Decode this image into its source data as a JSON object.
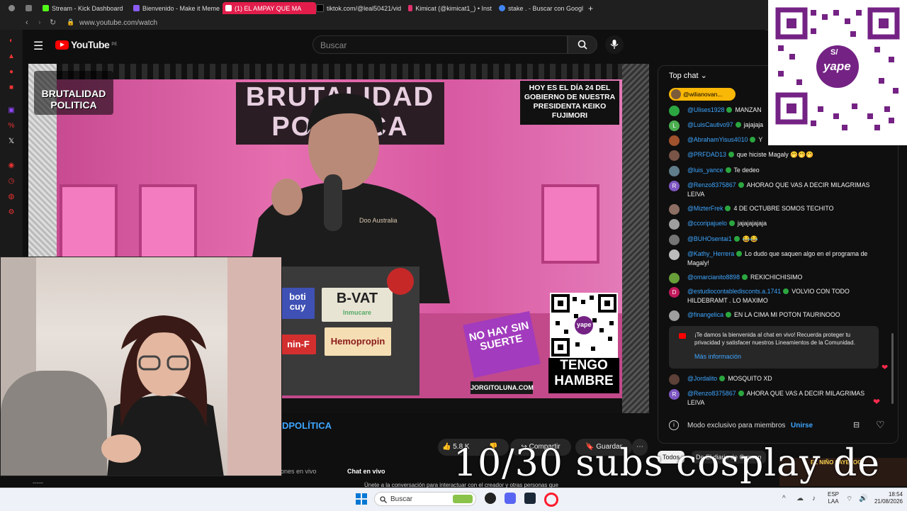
{
  "browser": {
    "tabs": [
      {
        "label": "Stream - Kick Dashboard",
        "color": "#53fc18"
      },
      {
        "label": "Bienvenido - Make it Meme",
        "color": "#8b5cf6"
      },
      {
        "label": "(1) EL AMPAY QUE MA",
        "color": "#ff0000",
        "active": true
      },
      {
        "label": "tiktok.com/@leal50421/vid",
        "color": "#000000"
      },
      {
        "label": "Kimicat (@kimicat1_) • Inst",
        "color": "#e1306c"
      },
      {
        "label": "stake . - Buscar con Googl",
        "color": "#4285f4"
      }
    ],
    "new_tab": "+",
    "url": "www.youtube.com/watch"
  },
  "youtube": {
    "logo": "YouTube",
    "region": "PE",
    "search_placeholder": "Buscar"
  },
  "video": {
    "brand": "BRUTALIDAD POLITICA",
    "sign_line1": "BRUTALIDAD",
    "sign_line2": "POLITICA",
    "day_text": "HOY ES EL DÍA 24 DEL GOBIERNO DE NUESTRA PRESIDENTA KEIKO FUJIMORI",
    "shirt_text": "Doo Australia",
    "stickers": [
      "boti cuy",
      "B-VAT",
      "Inmucare",
      "Hemopropin",
      "nin-F"
    ],
    "qr_label": "yape",
    "hambre": "TENGO HAMBRE",
    "nohay": "NO HAY SIN SUERTE",
    "jorgito": "JORGITOLUNA.COM"
  },
  "below": {
    "title_fragment": "DPOLÍTICA",
    "likes": "5.8 K",
    "share": "Compartir",
    "save": "Guardar",
    "more": "⋯",
    "live_tab": "ones en vivo",
    "chat_tab": "Chat en vivo",
    "join_text": "Únete a la conversación para interactuar con el creador y otras personas que"
  },
  "chat": {
    "header": "Top chat",
    "pinned": "@wilianovan...",
    "messages": [
      {
        "author": "@Ulises1928",
        "text": "MANZAN",
        "color": "#2ba640",
        "initial": ""
      },
      {
        "author": "@LuisCautivo97",
        "text": "jajajaja",
        "color": "#4caf50",
        "initial": "L"
      },
      {
        "author": "@AbrahamYisus4010",
        "text": "Y",
        "color": "#a0522d",
        "initial": ""
      },
      {
        "author": "@PRFDAD13",
        "text": "que hiciste Magaly 🤭🤭🤭",
        "color": "#795548",
        "initial": ""
      },
      {
        "author": "@luis_yance",
        "text": "Te dedeo",
        "color": "#607d8b",
        "initial": ""
      },
      {
        "author": "@Renzo8375867",
        "text": "AHORAO QUE VAS A DECIR MILAGRIMAS LEIVA",
        "color": "#7e57c2",
        "initial": "R"
      },
      {
        "author": "@MizterFrek",
        "text": "4 DE OCTUBRE SOMOS TECHITO",
        "color": "#8d6e63",
        "initial": ""
      },
      {
        "author": "@ccoripajuelo",
        "text": "jajajajajaja",
        "color": "#9e9e9e",
        "initial": ""
      },
      {
        "author": "@BUHOsentai1",
        "text": "😂😂",
        "color": "#757575",
        "initial": ""
      },
      {
        "author": "@Kathy_Herrera",
        "text": "Lo dudo que saquen algo en el programa de Magaly!",
        "color": "#bdbdbd",
        "initial": ""
      },
      {
        "author": "@omarcianito8898",
        "text": "REKICHICHISIMO",
        "color": "#689f38",
        "initial": ""
      },
      {
        "author": "@estudiocontabledisconts.a.1741",
        "text": "VOLVIO CON TODO HILDEBRAMT . LO MAXIMO",
        "color": "#c2185b",
        "initial": "D"
      },
      {
        "author": "@finangelica",
        "text": "EN LA CIMA MI POTON TAURINOOO",
        "color": "#9e9e9e",
        "initial": ""
      }
    ],
    "welcome_text": "¡Te damos la bienvenida al chat en vivo! Recuerda proteger tu privacidad y satisfacer nuestros Lineamientos de la Comunidad.",
    "welcome_link": "Más información",
    "after": [
      {
        "author": "@Jordalito",
        "text": "MOSQUITO XD",
        "color": "#5d4037",
        "initial": ""
      },
      {
        "author": "@Renzo8375867",
        "text": "AHORA QUE VAS A DECIR MILAGRIMAS LEIVA",
        "color": "#7e57c2",
        "initial": "R"
      }
    ],
    "members_text": "Modo exclusivo para miembros",
    "join": "Unirse"
  },
  "filters": [
    "Todos",
    "De El diario de Curwen"
  ],
  "overlay_text": "10/30 subs cosplay de",
  "qr_overlay": {
    "label": "yape",
    "currency": "S/"
  },
  "rec_label": "EL NIÑO PAYELOO",
  "taskbar": {
    "search": "Buscar",
    "lang1": "ESP",
    "lang2": "LAA",
    "time": "18:54",
    "date": "21/08/2026"
  }
}
